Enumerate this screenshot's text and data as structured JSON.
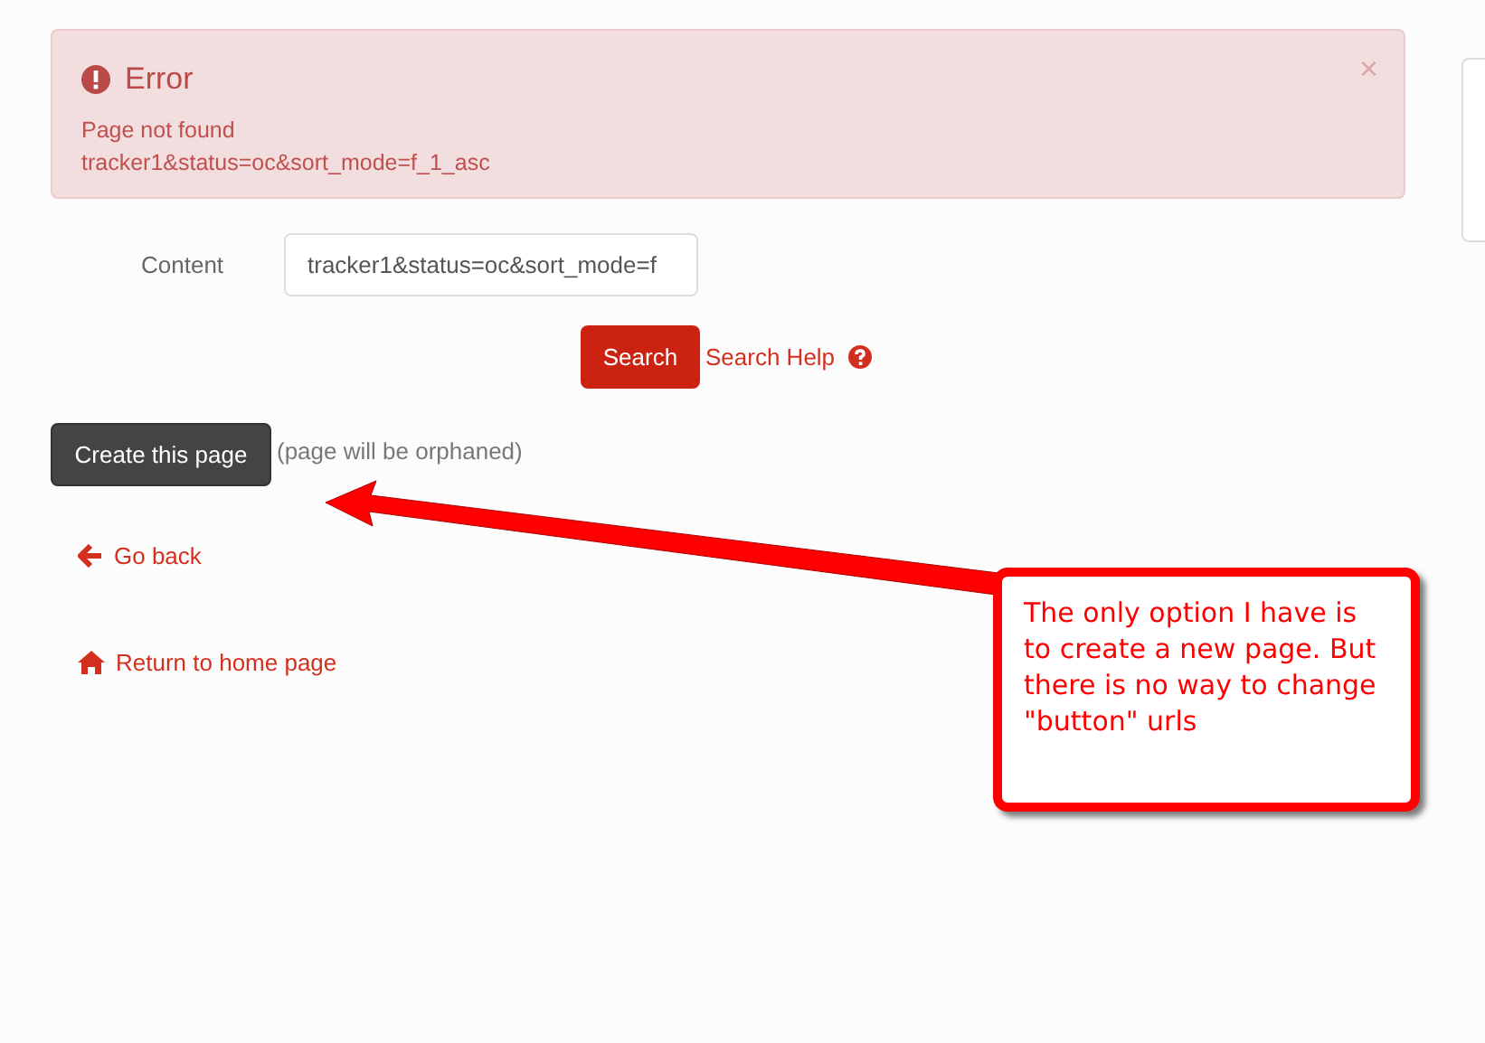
{
  "alert": {
    "title": "Error",
    "close": "×",
    "lines": [
      "Page not found",
      "tracker1&status=oc&sort_mode=f_1_asc"
    ]
  },
  "form": {
    "label": "Content",
    "value": "tracker1&status=oc&sort_mode=f",
    "search_button": "Search",
    "help_link": "Search Help"
  },
  "create": {
    "button": "Create this page",
    "note": "(page will be orphaned)"
  },
  "links": [
    {
      "kind": "back",
      "label": "Go back"
    },
    {
      "kind": "home",
      "label": "Return to home page"
    }
  ],
  "annotation": {
    "text": "The only option I have is to create a new page. But there is no way to change \"button\" urls"
  }
}
